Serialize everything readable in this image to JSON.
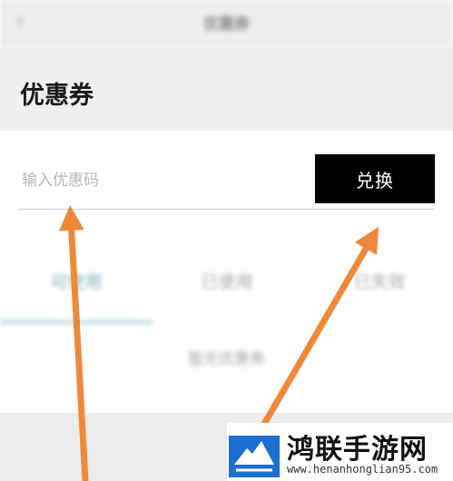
{
  "nav": {
    "back_glyph": "‹",
    "title": "优惠券"
  },
  "header": {
    "title": "优惠券"
  },
  "coupon_input": {
    "placeholder": "输入优惠码",
    "value": ""
  },
  "redeem_button": {
    "label": "兑换"
  },
  "tabs": [
    {
      "label": "可使用",
      "active": true
    },
    {
      "label": "已使用",
      "active": false
    },
    {
      "label": "已失效",
      "active": false
    }
  ],
  "empty_text": "暂无优惠券",
  "annotation": {
    "arrow_color": "#f0883a"
  },
  "watermark": {
    "brand": "鸿联手游网",
    "site": "www.henanhonglian95.com"
  },
  "colors": {
    "accent": "#7bb3b6",
    "button_bg": "#000000"
  }
}
